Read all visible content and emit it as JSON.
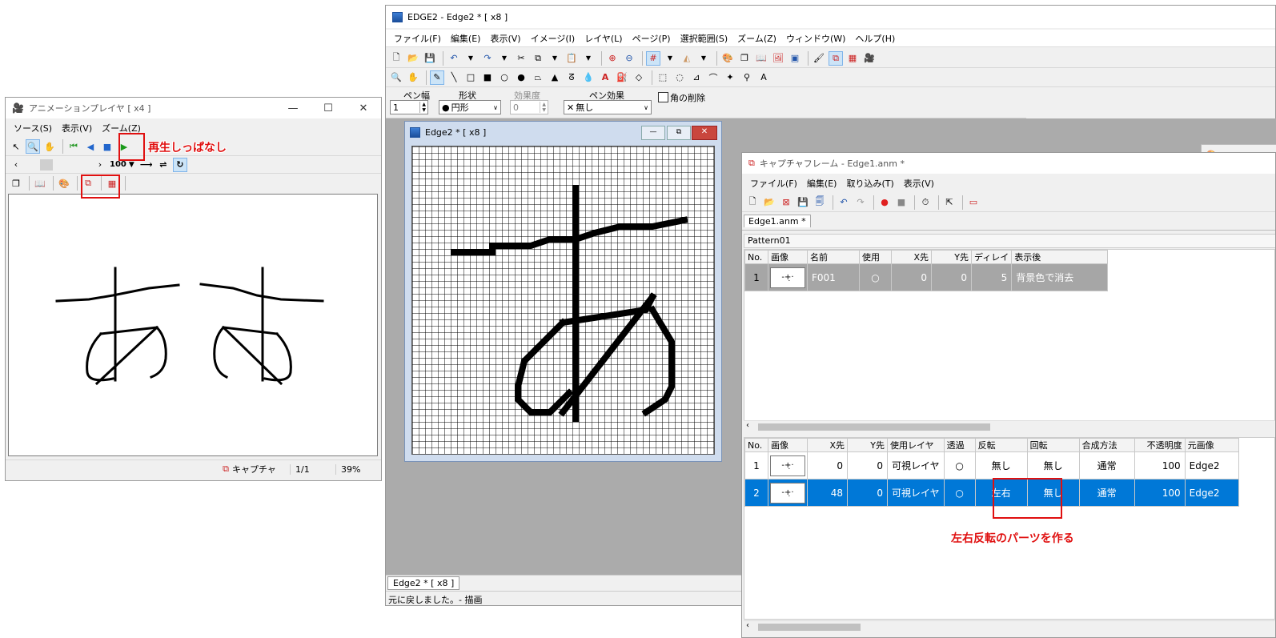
{
  "anim_player": {
    "title": "アニメーションプレイヤ [ x4 ]",
    "menu": [
      "ソース(S)",
      "表示(V)",
      "ズーム(Z)"
    ],
    "zoom_value": "100",
    "status": {
      "capture": "キャプチャ",
      "frame": "1/1",
      "zoom": "39%"
    }
  },
  "annotations": {
    "play_note": "再生しっぱなし",
    "flip_note": "左右反転のパーツを作る"
  },
  "edge2": {
    "title": "EDGE2 - Edge2 * [ x8 ]",
    "menu": [
      "ファイル(F)",
      "編集(E)",
      "表示(V)",
      "イメージ(I)",
      "レイヤ(L)",
      "ページ(P)",
      "選択範囲(S)",
      "ズーム(Z)",
      "ウィンドウ(W)",
      "ヘルプ(H)"
    ],
    "pen": {
      "width_label": "ペン幅",
      "width_value": "1",
      "shape_label": "形状",
      "shape_value": "円形",
      "effect_label": "効果度",
      "effect_value": "0",
      "pen_effect_label": "ペン効果",
      "pen_effect_value": "無し",
      "corner_label": "角の削除"
    },
    "doc_title": "Edge2 * [ x8 ]",
    "tab": "Edge2 * [ x8 ]",
    "status": "元に戻しました。- 描画"
  },
  "capture": {
    "title": "キャプチャフレーム - Edge1.anm *",
    "menu": [
      "ファイル(F)",
      "編集(E)",
      "取り込み(T)",
      "表示(V)"
    ],
    "tab": "Edge1.anm *",
    "pattern": "Pattern01",
    "frame_headers": [
      "No.",
      "画像",
      "名前",
      "使用",
      "X先",
      "Y先",
      "ディレイ",
      "表示後"
    ],
    "frame_rows": [
      {
        "no": "1",
        "name": "F001",
        "use": "○",
        "x": "0",
        "y": "0",
        "delay": "5",
        "after": "背景色で消去"
      }
    ],
    "part_headers": [
      "No.",
      "画像",
      "X先",
      "Y先",
      "使用レイヤ",
      "透過",
      "反転",
      "回転",
      "合成方法",
      "不透明度",
      "元画像"
    ],
    "part_rows": [
      {
        "no": "1",
        "x": "0",
        "y": "0",
        "layer": "可視レイヤ",
        "trans": "○",
        "flip": "無し",
        "rot": "無し",
        "blend": "通常",
        "opacity": "100",
        "src": "Edge2"
      },
      {
        "no": "2",
        "x": "48",
        "y": "0",
        "layer": "可視レイヤ",
        "trans": "○",
        "flip": "左右",
        "rot": "無し",
        "blend": "通常",
        "opacity": "100",
        "src": "Edge2"
      }
    ]
  }
}
